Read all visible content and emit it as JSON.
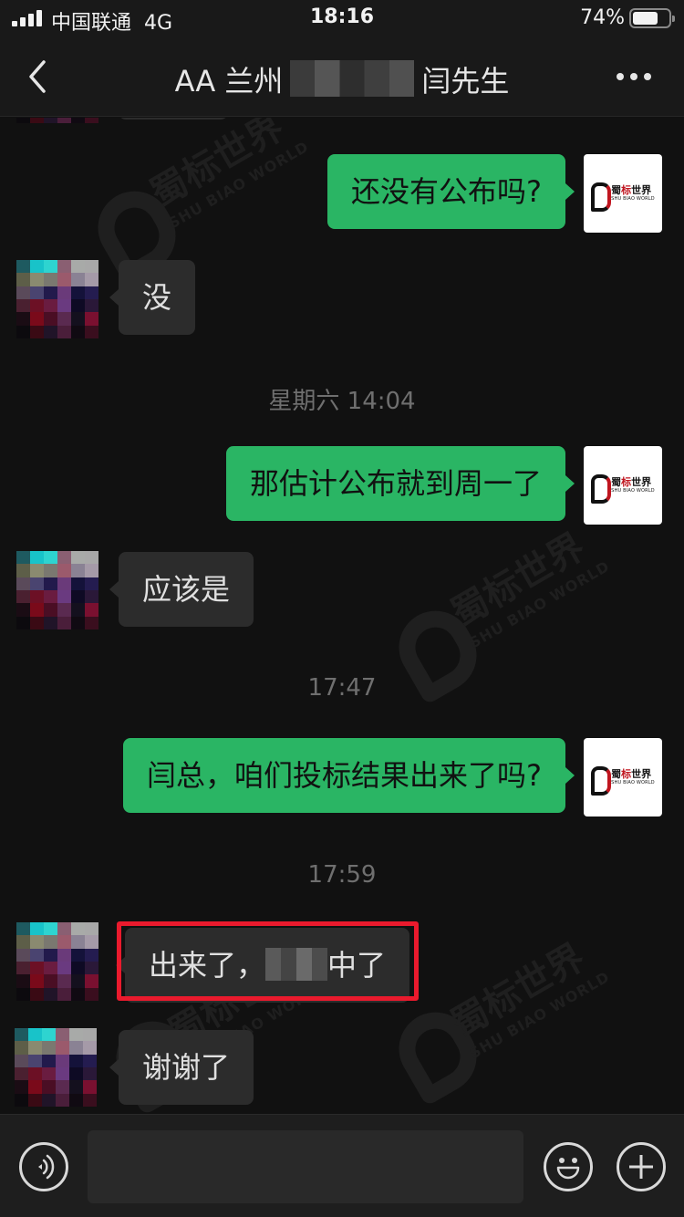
{
  "status_bar": {
    "carrier": "中国联通",
    "network": "4G",
    "time": "18:16",
    "battery_percent_label": "74%",
    "battery_level": 0.74
  },
  "nav": {
    "back_icon": "chevron-left-icon",
    "title_prefix": "AA 兰州",
    "title_suffix": "闫先生",
    "more_icon": "more-dots-icon"
  },
  "watermark": {
    "cn": "蜀标世界",
    "en": "SHU BIAO WORLD"
  },
  "contact_avatar_colors": [
    "#1e5a60",
    "#18c3c9",
    "#2ed4d0",
    "#8a5f72",
    "#a8aaa8",
    "#a8a8a8",
    "#5d5e48",
    "#8a8a70",
    "#7a7870",
    "#9b5a6c",
    "#8a8294",
    "#a59aa8",
    "#5a4a5a",
    "#4a4470",
    "#221a4c",
    "#6a3a7a",
    "#14123a",
    "#241c50",
    "#4a2030",
    "#6c1025",
    "#6a1c40",
    "#6a3a80",
    "#0e0a24",
    "#2a1838",
    "#1a0c14",
    "#7a0a1a",
    "#4a0e24",
    "#5a2a50",
    "#14101e",
    "#7a1030",
    "#0c0a0e",
    "#3a0a14",
    "#201428",
    "#4a1e3a",
    "#100a12",
    "#3a0e1e"
  ],
  "self_avatar": {
    "logo_cn_prefix": "蜀",
    "logo_cn_accent": "标",
    "logo_cn_suffix": "世界",
    "logo_en": "SHU BIAO WORLD"
  },
  "messages": [
    {
      "type": "out",
      "text": "还没有公布吗?"
    },
    {
      "type": "in",
      "text": "没"
    },
    {
      "type": "time",
      "text": "星期六 14:04"
    },
    {
      "type": "out",
      "text": "那估计公布就到周一了"
    },
    {
      "type": "in",
      "text": "应该是"
    },
    {
      "type": "time",
      "text": "17:47"
    },
    {
      "type": "out",
      "text": "闫总，咱们投标结果出来了吗?"
    },
    {
      "type": "time",
      "text": "17:59"
    },
    {
      "type": "in",
      "text_before": "出来了，",
      "text_after": "中了",
      "redacted": true,
      "highlighted": true
    },
    {
      "type": "in",
      "text": "谢谢了"
    }
  ],
  "input_bar": {
    "voice_icon": "voice-icon",
    "input_value": "",
    "emoji_icon": "emoji-icon",
    "plus_icon": "plus-icon"
  },
  "colors": {
    "background": "#111111",
    "outgoing_bubble": "#2ab564",
    "incoming_bubble": "#2c2c2c",
    "highlight_border": "#ea1a2d"
  }
}
